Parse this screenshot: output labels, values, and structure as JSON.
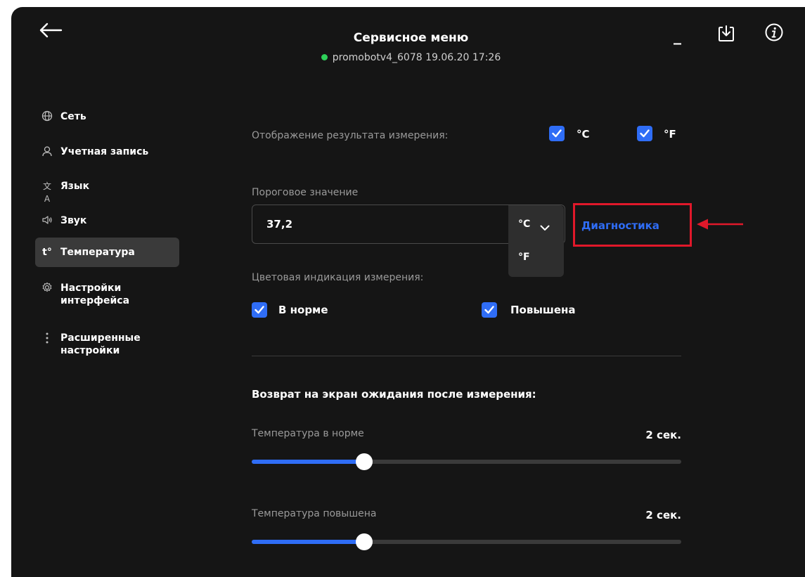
{
  "header": {
    "title": "Сервисное меню",
    "subtitle": "promobotv4_6078 19.06.20  17:26",
    "minimize_label": "_",
    "status_color": "#2ed159"
  },
  "sidebar": {
    "items": [
      {
        "label": "Сеть",
        "icon": "globe-icon"
      },
      {
        "label": "Учетная запись",
        "icon": "user-icon"
      },
      {
        "label": "Язык",
        "icon": "translate-icon"
      },
      {
        "label": "Звук",
        "icon": "speaker-icon"
      },
      {
        "label": "Температура",
        "icon": "thermometer-icon",
        "active": true
      },
      {
        "label": "Настройки интерфейса",
        "icon": "gear-icon"
      },
      {
        "label": "Расширенные настройки",
        "icon": "more-vertical-icon"
      }
    ]
  },
  "main": {
    "display_label": "Отображение результата измерения:",
    "unit_c": "°C",
    "unit_f": "°F",
    "threshold_label": "Пороговое значение",
    "threshold_value": "37,2",
    "unit_selected": "°C",
    "unit_option_f": "°F",
    "diagnostics": "Диагностика",
    "color_label": "Цветовая индикация измерения:",
    "normal_label": "В норме",
    "elevated_label": "Повышена",
    "section_title": "Возврат на экран ожидания после измерения:",
    "sliders": [
      {
        "label": "Температура в норме",
        "value_text": "2 сек.",
        "fraction": 0.262
      },
      {
        "label": "Температура повышена",
        "value_text": "2 сек.",
        "fraction": 0.262
      }
    ]
  },
  "colors": {
    "accent": "#2f6df6",
    "highlight": "#e0182a",
    "background": "#151515"
  }
}
